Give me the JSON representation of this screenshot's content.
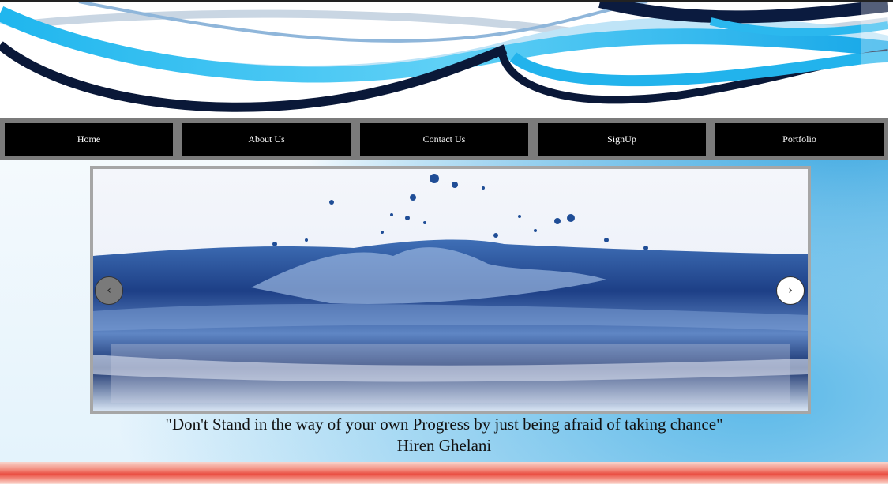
{
  "nav": {
    "items": [
      {
        "label": "Home"
      },
      {
        "label": "About Us"
      },
      {
        "label": "Contact Us"
      },
      {
        "label": "SignUp"
      },
      {
        "label": "Portfolio"
      }
    ]
  },
  "slider": {
    "prev_label": "‹",
    "next_label": "›"
  },
  "quote": {
    "text": "\"Don't Stand in the way of your own Progress by just being afraid of taking chance\"",
    "author": "Hiren Ghelani"
  },
  "colors": {
    "nav_bg": "#7b7b7b",
    "nav_item_bg": "#000000",
    "nav_text": "#ffffff",
    "footer_accent": "#ea4e42"
  }
}
